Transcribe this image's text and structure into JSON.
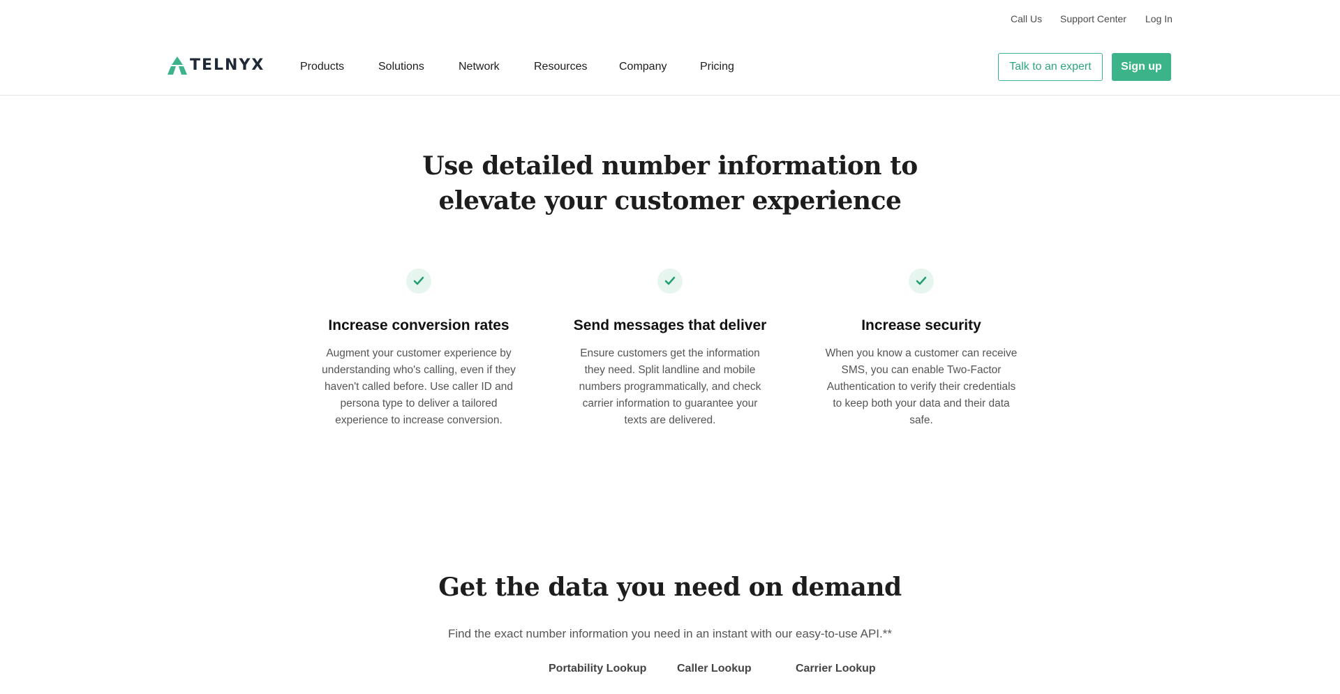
{
  "utility": {
    "call_us": "Call Us",
    "support_center": "Support Center",
    "log_in": "Log In"
  },
  "nav": {
    "logo_text": "TELNYX",
    "items": [
      "Products",
      "Solutions",
      "Network",
      "Resources",
      "Company",
      "Pricing"
    ],
    "talk_to_expert": "Talk to an expert",
    "sign_up": "Sign up"
  },
  "section1": {
    "heading_line1": "Use detailed number information to",
    "heading_line2": "elevate your customer experience",
    "features": [
      {
        "title": "Increase conversion rates",
        "text": "Augment your customer experience by understanding who's calling, even if they haven't called before. Use caller ID and persona type to deliver a tailored experience to increase conversion."
      },
      {
        "title": "Send messages that deliver",
        "text": "Ensure customers get the information they need. Split landline and mobile numbers programmatically, and check carrier information to guarantee your texts are delivered."
      },
      {
        "title": "Increase security",
        "text": "When you know a customer can receive SMS, you can enable Two-Factor Authentication to verify their credentials to keep both your data and their data safe."
      }
    ]
  },
  "section2": {
    "heading": "Get the data you need on demand",
    "lead": "Find the exact number information you need in an instant with our easy-to-use API.**",
    "tabs": [
      "Portability Lookup",
      "Caller Lookup",
      "Carrier Lookup"
    ]
  },
  "colors": {
    "accent": "#3db38a",
    "accent_light": "#e6f6ef",
    "text_dark": "#1d1d1d",
    "text_body": "#555555"
  }
}
